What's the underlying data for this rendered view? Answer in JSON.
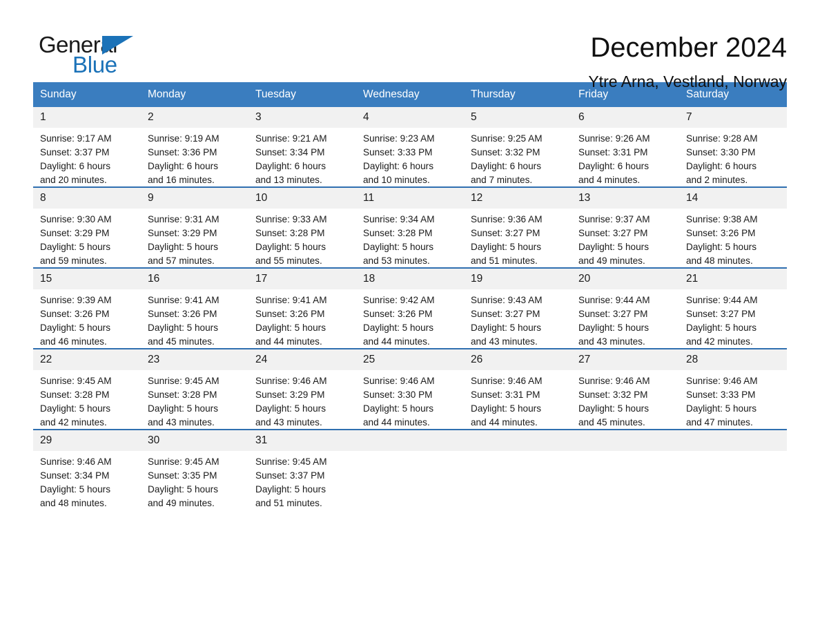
{
  "brand": {
    "name_part1": "General",
    "name_part2": "Blue",
    "accent_color": "#1b72b8"
  },
  "header": {
    "title": "December 2024",
    "subtitle": "Ytre Arna, Vestland, Norway"
  },
  "theme": {
    "header_row_color": "#3a7dbf",
    "row_divider_color": "#2f6fb0",
    "daynum_band_color": "#f1f1f1"
  },
  "weekday_headers": [
    "Sunday",
    "Monday",
    "Tuesday",
    "Wednesday",
    "Thursday",
    "Friday",
    "Saturday"
  ],
  "weeks": [
    [
      {
        "day": "1",
        "sunrise": "Sunrise: 9:17 AM",
        "sunset": "Sunset: 3:37 PM",
        "daylight1": "Daylight: 6 hours",
        "daylight2": "and 20 minutes."
      },
      {
        "day": "2",
        "sunrise": "Sunrise: 9:19 AM",
        "sunset": "Sunset: 3:36 PM",
        "daylight1": "Daylight: 6 hours",
        "daylight2": "and 16 minutes."
      },
      {
        "day": "3",
        "sunrise": "Sunrise: 9:21 AM",
        "sunset": "Sunset: 3:34 PM",
        "daylight1": "Daylight: 6 hours",
        "daylight2": "and 13 minutes."
      },
      {
        "day": "4",
        "sunrise": "Sunrise: 9:23 AM",
        "sunset": "Sunset: 3:33 PM",
        "daylight1": "Daylight: 6 hours",
        "daylight2": "and 10 minutes."
      },
      {
        "day": "5",
        "sunrise": "Sunrise: 9:25 AM",
        "sunset": "Sunset: 3:32 PM",
        "daylight1": "Daylight: 6 hours",
        "daylight2": "and 7 minutes."
      },
      {
        "day": "6",
        "sunrise": "Sunrise: 9:26 AM",
        "sunset": "Sunset: 3:31 PM",
        "daylight1": "Daylight: 6 hours",
        "daylight2": "and 4 minutes."
      },
      {
        "day": "7",
        "sunrise": "Sunrise: 9:28 AM",
        "sunset": "Sunset: 3:30 PM",
        "daylight1": "Daylight: 6 hours",
        "daylight2": "and 2 minutes."
      }
    ],
    [
      {
        "day": "8",
        "sunrise": "Sunrise: 9:30 AM",
        "sunset": "Sunset: 3:29 PM",
        "daylight1": "Daylight: 5 hours",
        "daylight2": "and 59 minutes."
      },
      {
        "day": "9",
        "sunrise": "Sunrise: 9:31 AM",
        "sunset": "Sunset: 3:29 PM",
        "daylight1": "Daylight: 5 hours",
        "daylight2": "and 57 minutes."
      },
      {
        "day": "10",
        "sunrise": "Sunrise: 9:33 AM",
        "sunset": "Sunset: 3:28 PM",
        "daylight1": "Daylight: 5 hours",
        "daylight2": "and 55 minutes."
      },
      {
        "day": "11",
        "sunrise": "Sunrise: 9:34 AM",
        "sunset": "Sunset: 3:28 PM",
        "daylight1": "Daylight: 5 hours",
        "daylight2": "and 53 minutes."
      },
      {
        "day": "12",
        "sunrise": "Sunrise: 9:36 AM",
        "sunset": "Sunset: 3:27 PM",
        "daylight1": "Daylight: 5 hours",
        "daylight2": "and 51 minutes."
      },
      {
        "day": "13",
        "sunrise": "Sunrise: 9:37 AM",
        "sunset": "Sunset: 3:27 PM",
        "daylight1": "Daylight: 5 hours",
        "daylight2": "and 49 minutes."
      },
      {
        "day": "14",
        "sunrise": "Sunrise: 9:38 AM",
        "sunset": "Sunset: 3:26 PM",
        "daylight1": "Daylight: 5 hours",
        "daylight2": "and 48 minutes."
      }
    ],
    [
      {
        "day": "15",
        "sunrise": "Sunrise: 9:39 AM",
        "sunset": "Sunset: 3:26 PM",
        "daylight1": "Daylight: 5 hours",
        "daylight2": "and 46 minutes."
      },
      {
        "day": "16",
        "sunrise": "Sunrise: 9:41 AM",
        "sunset": "Sunset: 3:26 PM",
        "daylight1": "Daylight: 5 hours",
        "daylight2": "and 45 minutes."
      },
      {
        "day": "17",
        "sunrise": "Sunrise: 9:41 AM",
        "sunset": "Sunset: 3:26 PM",
        "daylight1": "Daylight: 5 hours",
        "daylight2": "and 44 minutes."
      },
      {
        "day": "18",
        "sunrise": "Sunrise: 9:42 AM",
        "sunset": "Sunset: 3:26 PM",
        "daylight1": "Daylight: 5 hours",
        "daylight2": "and 44 minutes."
      },
      {
        "day": "19",
        "sunrise": "Sunrise: 9:43 AM",
        "sunset": "Sunset: 3:27 PM",
        "daylight1": "Daylight: 5 hours",
        "daylight2": "and 43 minutes."
      },
      {
        "day": "20",
        "sunrise": "Sunrise: 9:44 AM",
        "sunset": "Sunset: 3:27 PM",
        "daylight1": "Daylight: 5 hours",
        "daylight2": "and 43 minutes."
      },
      {
        "day": "21",
        "sunrise": "Sunrise: 9:44 AM",
        "sunset": "Sunset: 3:27 PM",
        "daylight1": "Daylight: 5 hours",
        "daylight2": "and 42 minutes."
      }
    ],
    [
      {
        "day": "22",
        "sunrise": "Sunrise: 9:45 AM",
        "sunset": "Sunset: 3:28 PM",
        "daylight1": "Daylight: 5 hours",
        "daylight2": "and 42 minutes."
      },
      {
        "day": "23",
        "sunrise": "Sunrise: 9:45 AM",
        "sunset": "Sunset: 3:28 PM",
        "daylight1": "Daylight: 5 hours",
        "daylight2": "and 43 minutes."
      },
      {
        "day": "24",
        "sunrise": "Sunrise: 9:46 AM",
        "sunset": "Sunset: 3:29 PM",
        "daylight1": "Daylight: 5 hours",
        "daylight2": "and 43 minutes."
      },
      {
        "day": "25",
        "sunrise": "Sunrise: 9:46 AM",
        "sunset": "Sunset: 3:30 PM",
        "daylight1": "Daylight: 5 hours",
        "daylight2": "and 44 minutes."
      },
      {
        "day": "26",
        "sunrise": "Sunrise: 9:46 AM",
        "sunset": "Sunset: 3:31 PM",
        "daylight1": "Daylight: 5 hours",
        "daylight2": "and 44 minutes."
      },
      {
        "day": "27",
        "sunrise": "Sunrise: 9:46 AM",
        "sunset": "Sunset: 3:32 PM",
        "daylight1": "Daylight: 5 hours",
        "daylight2": "and 45 minutes."
      },
      {
        "day": "28",
        "sunrise": "Sunrise: 9:46 AM",
        "sunset": "Sunset: 3:33 PM",
        "daylight1": "Daylight: 5 hours",
        "daylight2": "and 47 minutes."
      }
    ],
    [
      {
        "day": "29",
        "sunrise": "Sunrise: 9:46 AM",
        "sunset": "Sunset: 3:34 PM",
        "daylight1": "Daylight: 5 hours",
        "daylight2": "and 48 minutes."
      },
      {
        "day": "30",
        "sunrise": "Sunrise: 9:45 AM",
        "sunset": "Sunset: 3:35 PM",
        "daylight1": "Daylight: 5 hours",
        "daylight2": "and 49 minutes."
      },
      {
        "day": "31",
        "sunrise": "Sunrise: 9:45 AM",
        "sunset": "Sunset: 3:37 PM",
        "daylight1": "Daylight: 5 hours",
        "daylight2": "and 51 minutes."
      },
      {
        "day": "",
        "sunrise": "",
        "sunset": "",
        "daylight1": "",
        "daylight2": ""
      },
      {
        "day": "",
        "sunrise": "",
        "sunset": "",
        "daylight1": "",
        "daylight2": ""
      },
      {
        "day": "",
        "sunrise": "",
        "sunset": "",
        "daylight1": "",
        "daylight2": ""
      },
      {
        "day": "",
        "sunrise": "",
        "sunset": "",
        "daylight1": "",
        "daylight2": ""
      }
    ]
  ]
}
